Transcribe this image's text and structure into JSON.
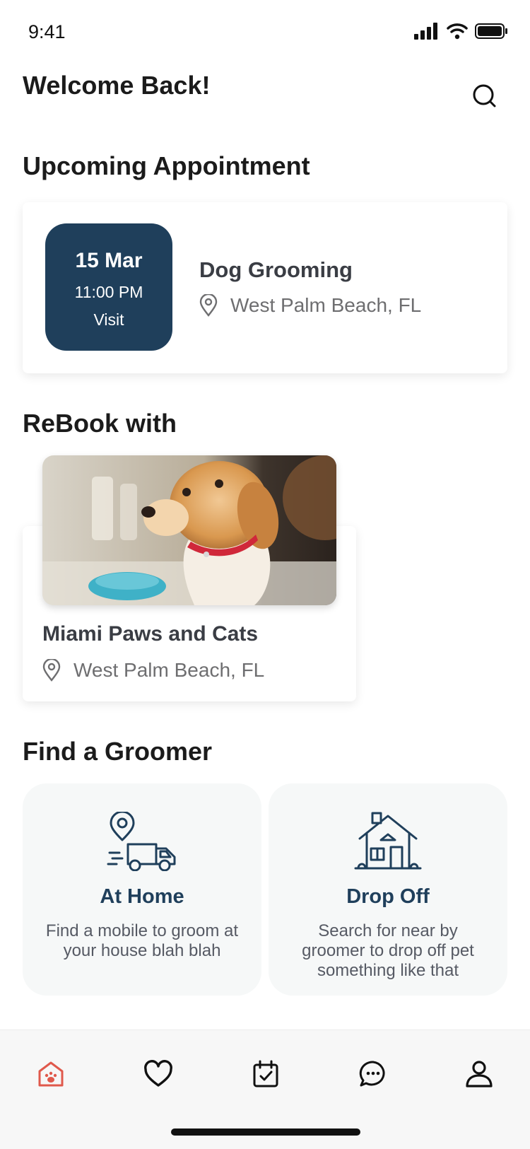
{
  "status": {
    "time": "9:41"
  },
  "header": {
    "title": "Welcome Back!"
  },
  "upcoming": {
    "section_title": "Upcoming Appointment",
    "date": "15 Mar",
    "time": "11:00 PM",
    "type": "Visit",
    "service": "Dog Grooming",
    "location": "West Palm Beach, FL"
  },
  "rebook": {
    "section_title": "ReBook with",
    "name": "Miami Paws and Cats",
    "location": "West Palm Beach, FL"
  },
  "find": {
    "section_title": "Find a Groomer",
    "options": [
      {
        "title": "At Home",
        "description": "Find a mobile to groom at your house blah blah"
      },
      {
        "title": "Drop Off",
        "description": "Search for near by groomer to drop off pet something like that"
      }
    ]
  },
  "colors": {
    "accent": "#1f3f5b",
    "active_tab": "#e0594c"
  }
}
